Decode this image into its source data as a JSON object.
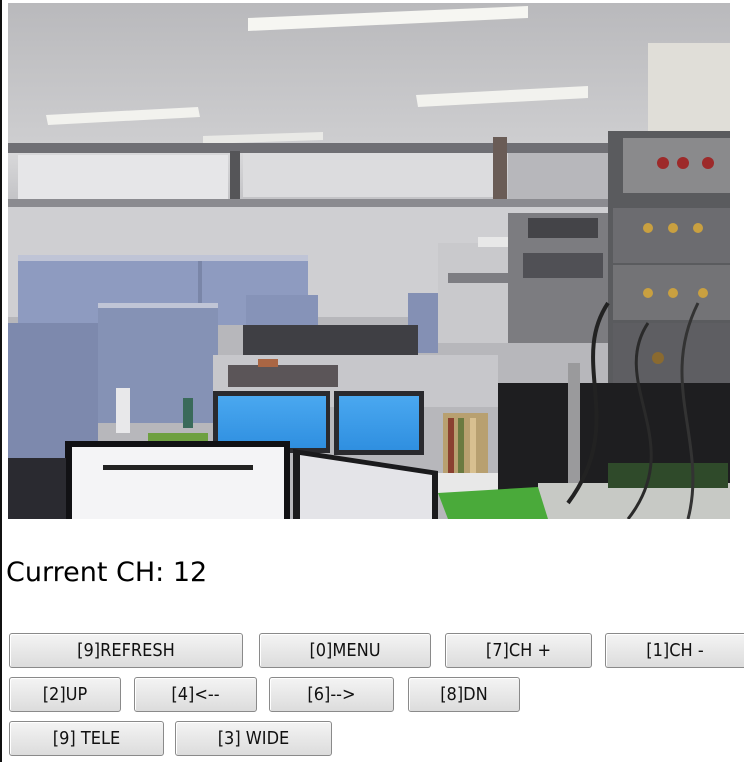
{
  "viewer": {
    "channel_label": "Current CH: 12"
  },
  "buttons": {
    "row1": [
      "[9]REFRESH",
      "[0]MENU",
      "[7]CH +",
      "[1]CH -"
    ],
    "row2": [
      "[2]UP",
      "[4]<--",
      "[6]-->",
      "[8]DN"
    ],
    "row3": [
      "[9] TELE",
      "[3] WIDE"
    ]
  },
  "colors": {
    "button_bg": "#e6e6e6",
    "button_border": "#8a8a8a",
    "text": "#000000"
  }
}
